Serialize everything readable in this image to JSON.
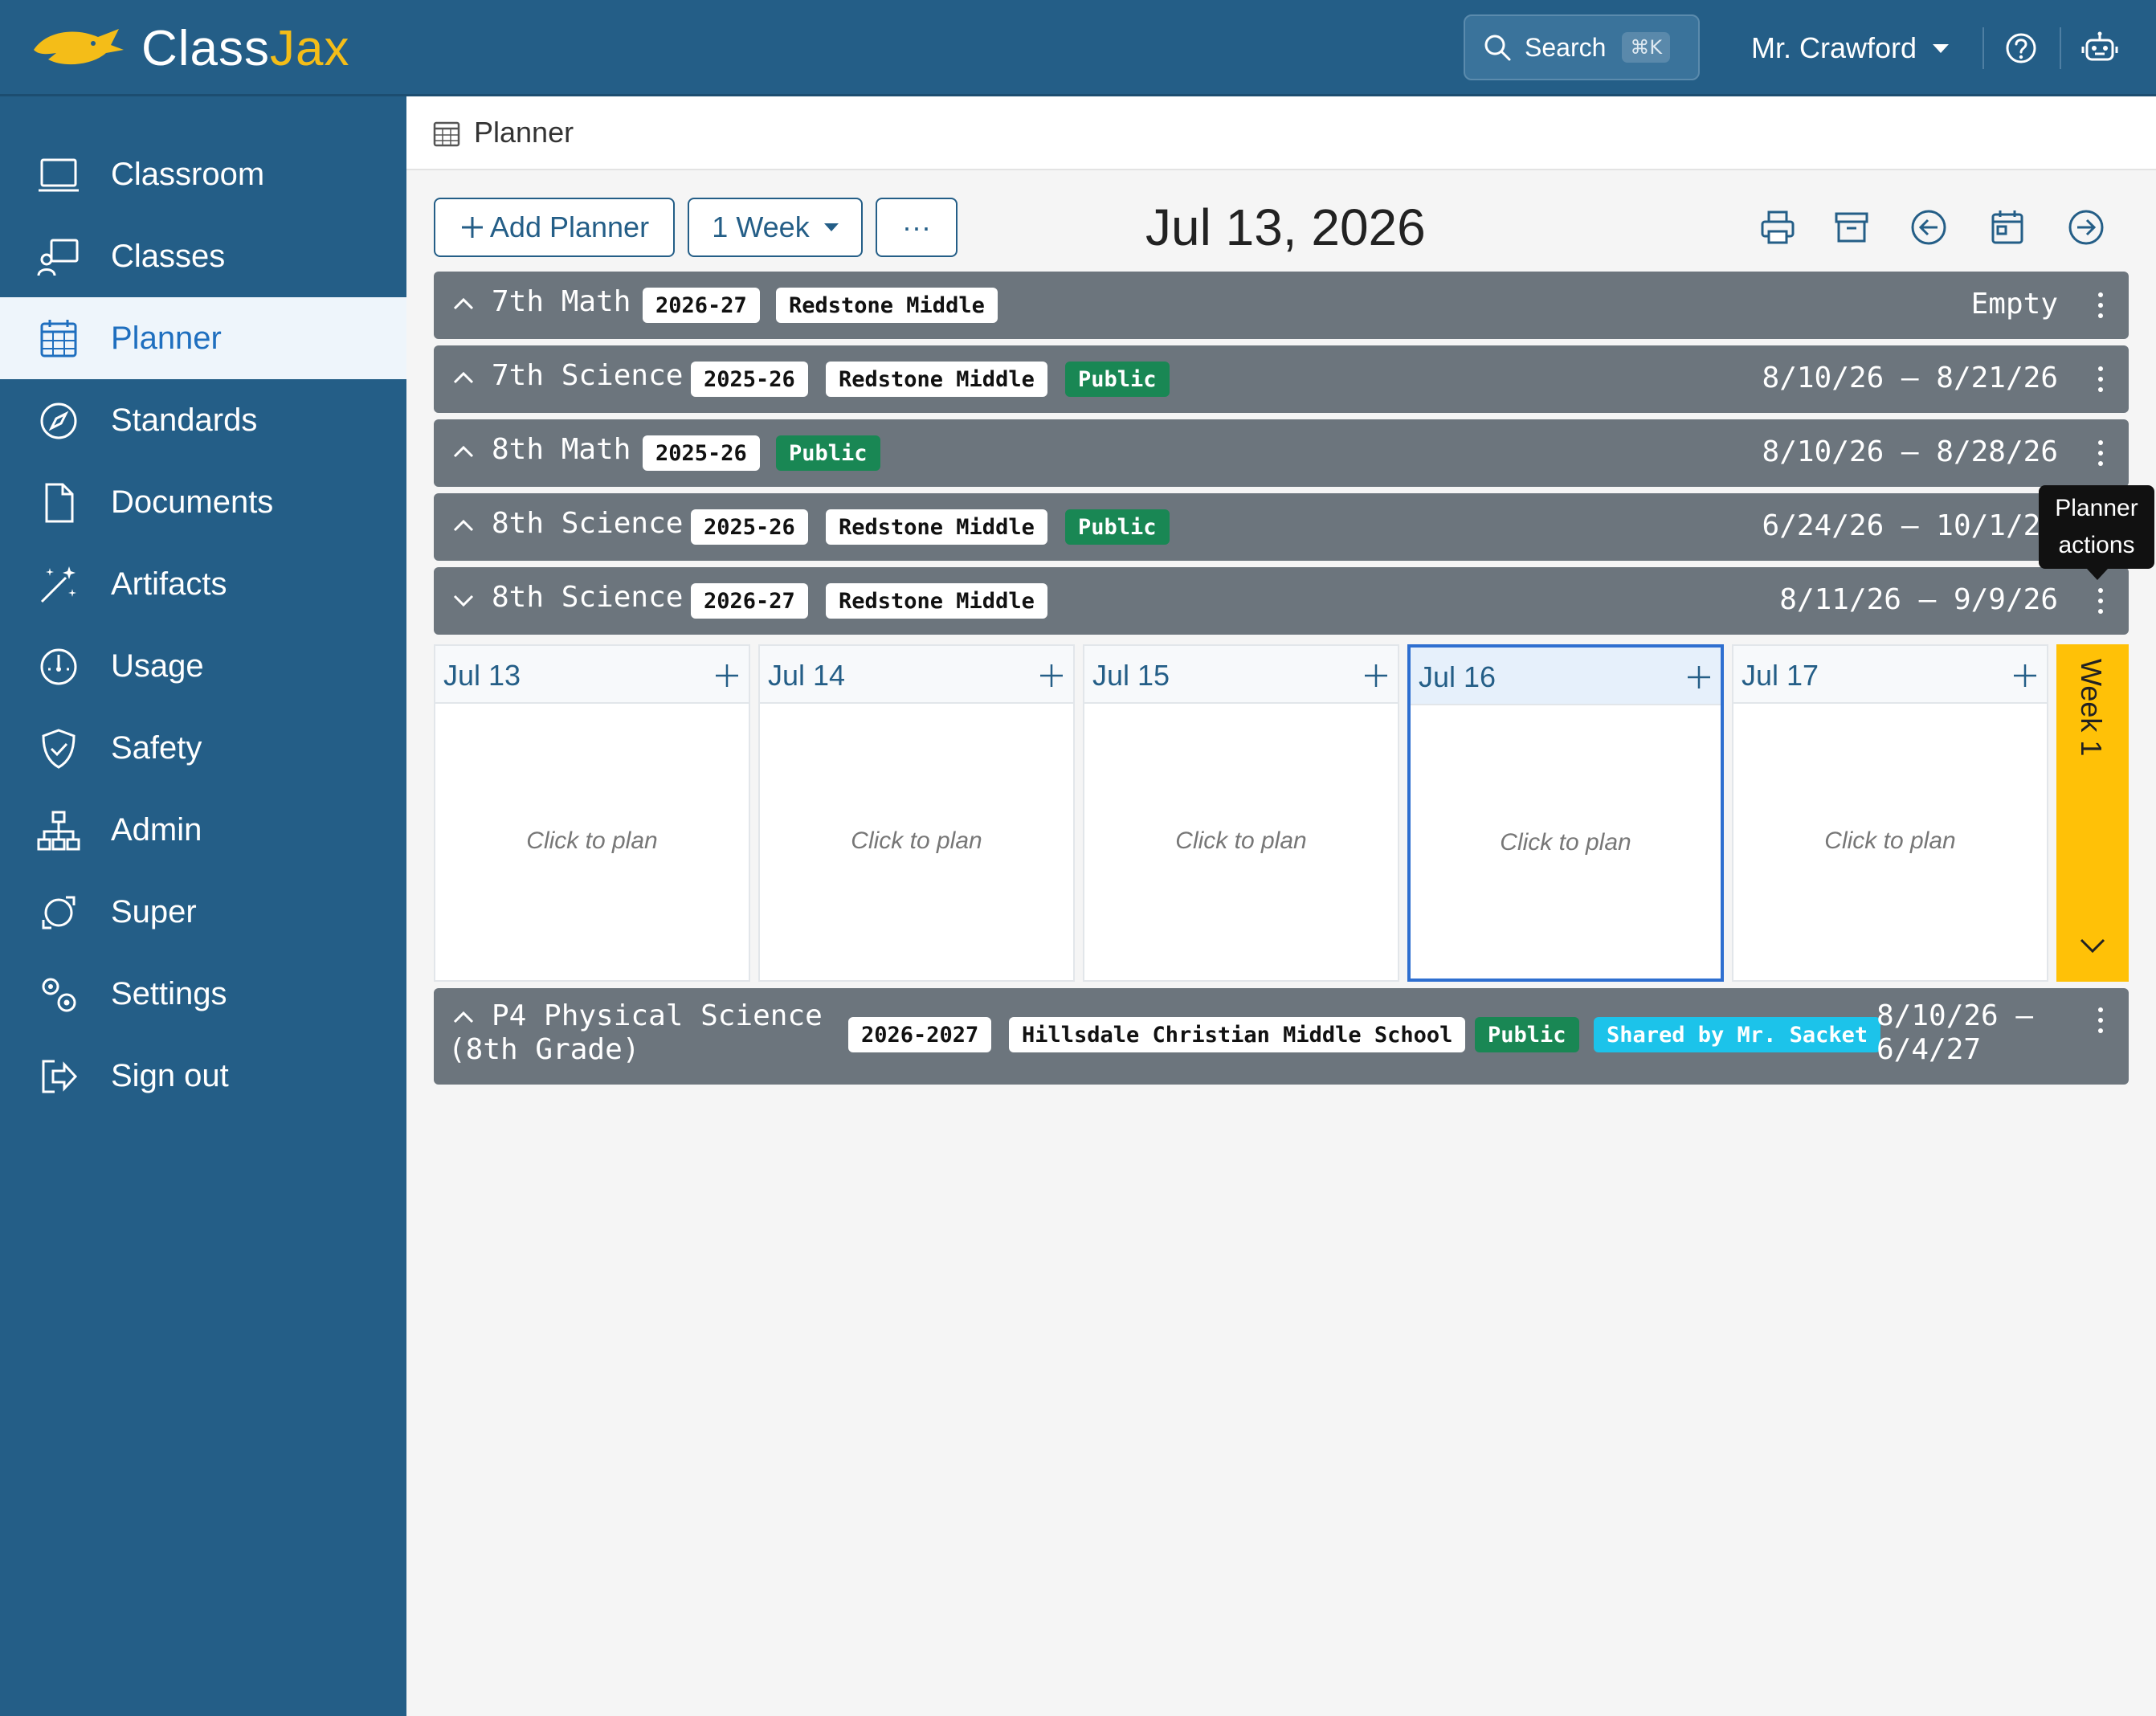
{
  "app": {
    "name_part1": "Class",
    "name_part2": "Jax",
    "search_label": "Search",
    "search_shortcut": "⌘K",
    "user_name": "Mr. Crawford"
  },
  "sidebar": {
    "items": [
      {
        "label": "Classroom",
        "icon": "classroom-icon",
        "active": false
      },
      {
        "label": "Classes",
        "icon": "classes-icon",
        "active": false
      },
      {
        "label": "Planner",
        "icon": "calendar-icon",
        "active": true
      },
      {
        "label": "Standards",
        "icon": "compass-icon",
        "active": false
      },
      {
        "label": "Documents",
        "icon": "document-icon",
        "active": false
      },
      {
        "label": "Artifacts",
        "icon": "magic-wand-icon",
        "active": false
      },
      {
        "label": "Usage",
        "icon": "speedometer-icon",
        "active": false
      },
      {
        "label": "Safety",
        "icon": "shield-check-icon",
        "active": false
      },
      {
        "label": "Admin",
        "icon": "hierarchy-icon",
        "active": false
      },
      {
        "label": "Super",
        "icon": "super-icon",
        "active": false
      },
      {
        "label": "Settings",
        "icon": "gears-icon",
        "active": false
      },
      {
        "label": "Sign out",
        "icon": "sign-out-icon",
        "active": false
      }
    ]
  },
  "header": {
    "title": "Planner"
  },
  "toolbar": {
    "add_label": "Add Planner",
    "range_label": "1 Week",
    "more_label": "···",
    "current_date": "Jul 13, 2026"
  },
  "planners": [
    {
      "name": "7th Math",
      "badges": [
        "2026-27",
        "Redstone Middle"
      ],
      "range": "Empty",
      "expanded": false
    },
    {
      "name": "7th Science",
      "badges": [
        "2025-26",
        "Redstone Middle",
        "Public"
      ],
      "range": "8/10/26 – 8/21/26",
      "expanded": false
    },
    {
      "name": "8th Math",
      "badges": [
        "2025-26",
        "Public"
      ],
      "range": "8/10/26 – 8/28/26",
      "expanded": false
    },
    {
      "name": "8th Science",
      "badges": [
        "2025-26",
        "Redstone Middle",
        "Public"
      ],
      "range": "6/24/26 – 10/1/26",
      "expanded": false
    },
    {
      "name": "8th Science",
      "badges": [
        "2026-27",
        "Redstone Middle"
      ],
      "range": "8/11/26 – 9/9/26",
      "expanded": true
    },
    {
      "name_line1": "P4 Physical Science",
      "name_line2": "(8th Grade)",
      "badges": [
        "2026-2027",
        "Hillsdale Christian Middle School",
        "Public",
        "Shared by Mr. Sacket"
      ],
      "range_line1": "8/10/26 –",
      "range_line2": "6/4/27",
      "expanded": false
    }
  ],
  "week": {
    "days": [
      {
        "label": "Jul 13",
        "hint": "Click to plan",
        "today": false
      },
      {
        "label": "Jul 14",
        "hint": "Click to plan",
        "today": false
      },
      {
        "label": "Jul 15",
        "hint": "Click to plan",
        "today": false
      },
      {
        "label": "Jul 16",
        "hint": "Click to plan",
        "today": true
      },
      {
        "label": "Jul 17",
        "hint": "Click to plan",
        "today": false
      }
    ],
    "week_label": "Week 1"
  },
  "tooltip": {
    "line1": "Planner",
    "line2": "actions"
  },
  "colors": {
    "brand": "#245e87",
    "accent": "#f4bd18",
    "row_bg": "#6c757d",
    "public": "#198754",
    "shared": "#1cc3ea",
    "week": "#ffc107",
    "today_border": "#2f6fd0"
  }
}
